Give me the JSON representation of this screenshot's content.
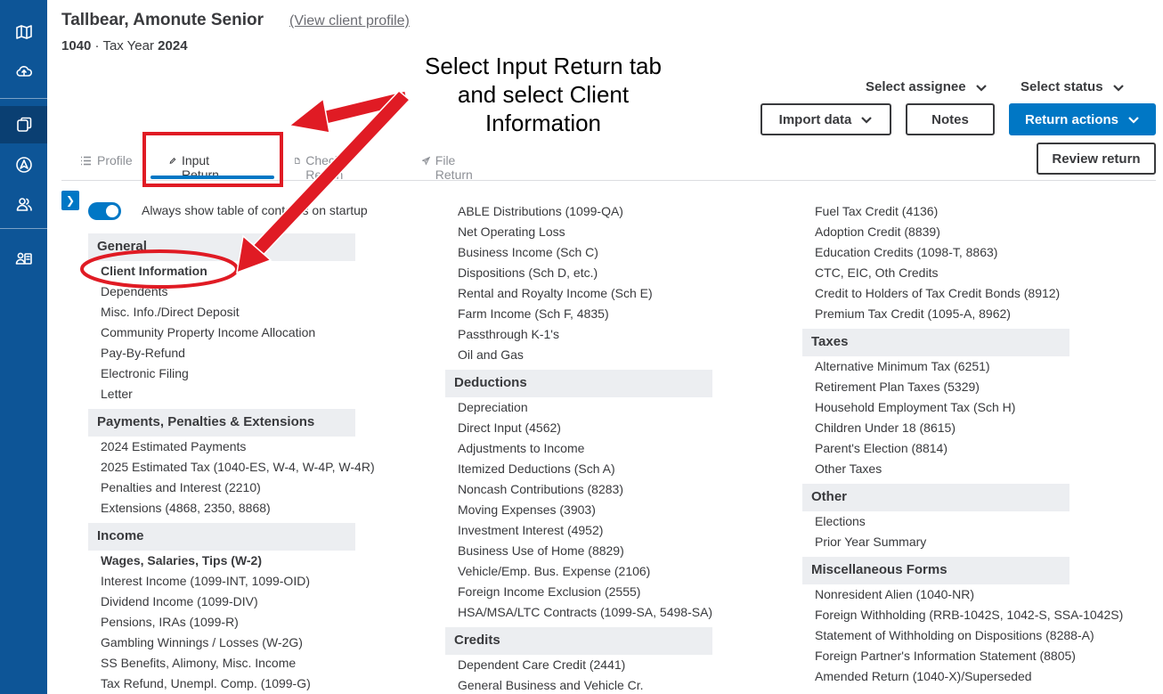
{
  "header": {
    "client_name": "Tallbear, Amonute Senior",
    "view_profile": "(View client profile)",
    "form": "1040",
    "tax_year_label": "· Tax Year",
    "tax_year": "2024"
  },
  "annotation": {
    "text": "Select Input Return tab and select Client Information"
  },
  "toolbar": {
    "select_assignee": "Select assignee",
    "select_status": "Select status",
    "import_data": "Import data",
    "notes": "Notes",
    "return_actions": "Return actions",
    "review_return": "Review return"
  },
  "tabs": [
    {
      "label": "Profile",
      "icon": "list-icon"
    },
    {
      "label": "Input Return",
      "icon": "pencil-icon"
    },
    {
      "label": "Check Return",
      "icon": "document-icon"
    },
    {
      "label": "File Return",
      "icon": "send-icon"
    }
  ],
  "toc_toggle_label": "Always show table of contents on startup",
  "columns": {
    "left": {
      "sections": [
        {
          "title": "General",
          "items": [
            "Client Information",
            "Dependents",
            "Misc. Info./Direct Deposit",
            "Community Property Income Allocation",
            "Pay-By-Refund",
            "Electronic Filing",
            "Letter"
          ]
        },
        {
          "title": "Payments, Penalties & Extensions",
          "items": [
            "2024 Estimated Payments",
            "2025 Estimated Tax (1040-ES, W-4, W-4P, W-4R)",
            "Penalties and Interest (2210)",
            "Extensions (4868, 2350, 8868)"
          ]
        },
        {
          "title": "Income",
          "items": [
            "Wages, Salaries, Tips (W-2)",
            "Interest Income (1099-INT, 1099-OID)",
            "Dividend Income (1099-DIV)",
            "Pensions, IRAs (1099-R)",
            "Gambling Winnings / Losses (W-2G)",
            "SS Benefits, Alimony, Misc. Income",
            "Tax Refund, Unempl. Comp. (1099-G)"
          ]
        }
      ]
    },
    "middle": {
      "top_items": [
        "ABLE Distributions (1099-QA)",
        "Net Operating Loss",
        "Business Income (Sch C)",
        "Dispositions (Sch D, etc.)",
        "Rental and Royalty Income (Sch E)",
        "Farm Income (Sch F, 4835)",
        "Passthrough K-1's",
        "Oil and Gas"
      ],
      "sections": [
        {
          "title": "Deductions",
          "items": [
            "Depreciation",
            "Direct Input (4562)",
            "Adjustments to Income",
            "Itemized Deductions (Sch A)",
            "Noncash Contributions (8283)",
            "Moving Expenses (3903)",
            "Investment Interest (4952)",
            "Business Use of Home (8829)",
            "Vehicle/Emp. Bus. Expense (2106)",
            "Foreign Income Exclusion (2555)",
            "HSA/MSA/LTC Contracts (1099-SA, 5498-SA)"
          ]
        },
        {
          "title": "Credits",
          "items": [
            "Dependent Care Credit (2441)",
            "General Business and Vehicle Cr."
          ]
        }
      ]
    },
    "right": {
      "top_items": [
        "Fuel Tax Credit (4136)",
        "Adoption Credit (8839)",
        "Education Credits (1098-T, 8863)",
        "CTC, EIC, Oth Credits",
        "Credit to Holders of Tax Credit Bonds (8912)",
        "Premium Tax Credit (1095-A, 8962)"
      ],
      "sections": [
        {
          "title": "Taxes",
          "items": [
            "Alternative Minimum Tax (6251)",
            "Retirement Plan Taxes (5329)",
            "Household Employment Tax (Sch H)",
            "Children Under 18 (8615)",
            "Parent's Election (8814)",
            "Other Taxes"
          ]
        },
        {
          "title": "Other",
          "items": [
            "Elections",
            "Prior Year Summary"
          ]
        },
        {
          "title": "Miscellaneous Forms",
          "items": [
            "Nonresident Alien (1040-NR)",
            "Foreign Withholding (RRB-1042S, 1042-S, SSA-1042S)",
            "Statement of Withholding on Dispositions (8288-A)",
            "Foreign Partner's Information Statement (8805)",
            "Amended Return (1040-X)/Superseded"
          ]
        }
      ]
    }
  },
  "colors": {
    "rail": "#0d5597",
    "accent": "#0077c5",
    "annotation_red": "#e01b24",
    "section_bg": "#eceef1"
  }
}
